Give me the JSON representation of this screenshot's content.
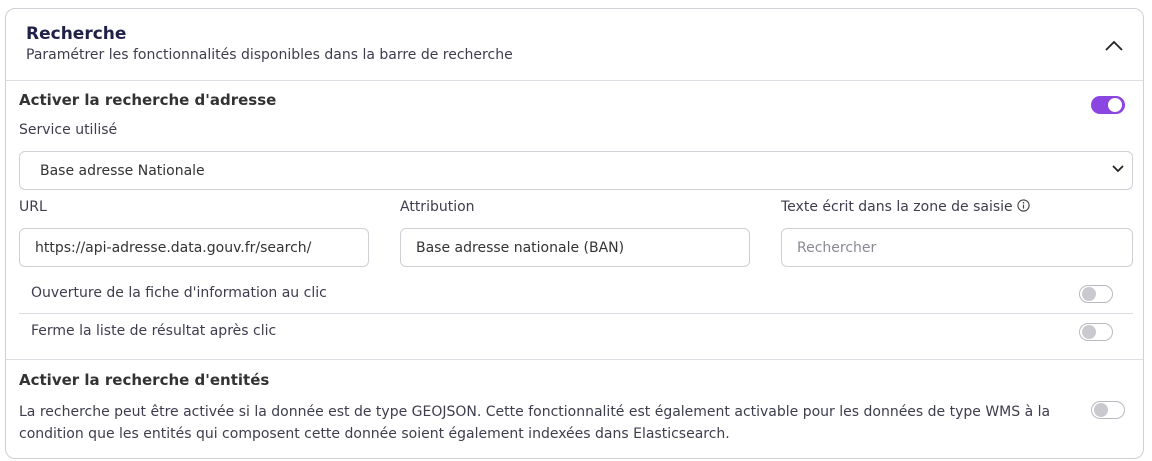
{
  "header": {
    "title": "Recherche",
    "subtitle": "Paramétrer les fonctionnalités disponibles dans la barre de recherche",
    "collapse_icon": "chevron-up-icon"
  },
  "address_search": {
    "title": "Activer la recherche d'adresse",
    "enabled": true,
    "service_label": "Service utilisé",
    "service_value": "Base adresse Nationale",
    "url_label": "URL",
    "url_value": "https://api-adresse.data.gouv.fr/search/",
    "attribution_label": "Attribution",
    "attribution_value": "Base adresse nationale (BAN)",
    "placeholder_label": "Texte écrit dans la zone de saisie",
    "placeholder_value": "Rechercher",
    "open_info_label": "Ouverture de la fiche d'information au clic",
    "open_info_enabled": false,
    "close_list_label": "Ferme la liste de résultat après clic",
    "close_list_enabled": false
  },
  "entity_search": {
    "title": "Activer la recherche d'entités",
    "description": "La recherche peut être activée si la donnée est de type GEOJSON. Cette fonctionnalité est également activable pour les données de type WMS à la condition que les entités qui composent cette donnée soient également indexées dans Elasticsearch.",
    "enabled": false
  },
  "colors": {
    "accent": "#8b45e0",
    "title": "#1f2147",
    "border": "#cfcfd6"
  }
}
